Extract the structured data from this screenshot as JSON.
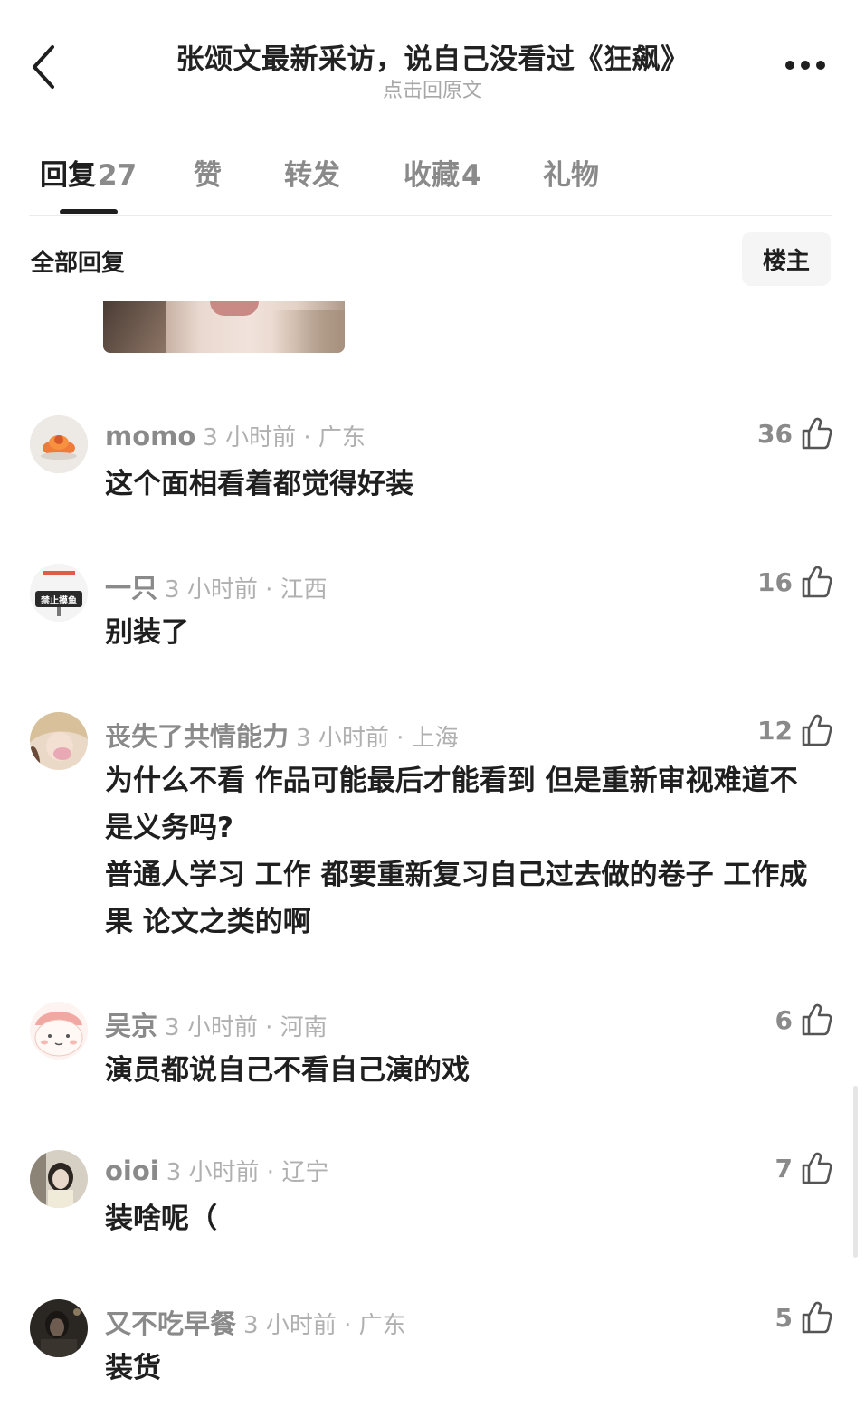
{
  "header": {
    "title": "张颂文最新采访，说自己没看过《狂飙》",
    "subtitle": "点击回原文"
  },
  "tabs": [
    {
      "label": "回复",
      "count": "27"
    },
    {
      "label": "赞",
      "count": ""
    },
    {
      "label": "转发",
      "count": ""
    },
    {
      "label": "收藏",
      "count": "4"
    },
    {
      "label": "礼物",
      "count": ""
    }
  ],
  "filter": {
    "all_label": "全部回复",
    "op_label": "楼主"
  },
  "comments": [
    {
      "name": "momo",
      "meta": "3 小时前 · 广东",
      "text": "这个面相看着都觉得好装",
      "likes": "36"
    },
    {
      "name": "一只",
      "meta": "3 小时前 · 江西",
      "text": "别装了",
      "likes": "16",
      "avatar_text": "禁止摸鱼"
    },
    {
      "name": "丧失了共情能力",
      "meta": "3 小时前 · 上海",
      "text": "为什么不看 作品可能最后才能看到 但是重新审视难道不是义务吗?\n普通人学习 工作 都要重新复习自己过去做的卷子 工作成果 论文之类的啊",
      "likes": "12"
    },
    {
      "name": "吴京",
      "meta": "3 小时前 · 河南",
      "text": "演员都说自己不看自己演的戏",
      "likes": "6"
    },
    {
      "name": "oioi",
      "meta": "3 小时前 · 辽宁",
      "text": "装啥呢（",
      "likes": "7"
    },
    {
      "name": "又不吃早餐",
      "meta": "3 小时前 · 广东",
      "text": "装货",
      "likes": "5"
    }
  ],
  "colors": {
    "text_primary": "#1f1f1f",
    "text_secondary": "#8a8a8a",
    "text_muted": "#b0b0b0",
    "button_bg": "#f5f5f5"
  }
}
